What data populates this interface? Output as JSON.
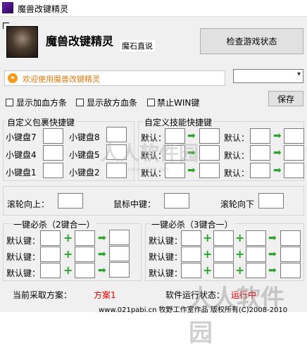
{
  "window": {
    "title": "魔兽改键精灵"
  },
  "header": {
    "app_name": "魔兽改键精灵",
    "subtitle": "魔石直说",
    "check_button": "检查游戏状态"
  },
  "welcome": {
    "text": "欢迎使用魔兽改键精灵"
  },
  "options": {
    "show_hp": "显示加血方条",
    "show_enemy_hp": "显示敌方血条",
    "disable_win": "禁止WIN键",
    "save_button": "保存",
    "dropdown_value": ""
  },
  "inventory": {
    "title": "自定义包裹快捷键",
    "slots": [
      {
        "label": "小键盘7"
      },
      {
        "label": "小键盘8"
      },
      {
        "label": "小键盘4"
      },
      {
        "label": "小键盘5"
      },
      {
        "label": "小键盘1"
      },
      {
        "label": "小键盘2"
      }
    ]
  },
  "skills": {
    "title": "自定义技能快捷键",
    "default_label": "默认："
  },
  "wheel": {
    "up": "滚轮向上：",
    "middle": "鼠标中键：",
    "down": "滚轮向下"
  },
  "combo2": {
    "title": "一键必杀（2键合一）",
    "default_label": "默认键："
  },
  "combo3": {
    "title": "一键必杀（3键合一）",
    "default_label": "默认键："
  },
  "status": {
    "current_label": "当前采取方案：",
    "current_value": "方案1",
    "running_label": "软件运行状态：",
    "running_value": "运行中"
  },
  "footer": {
    "text": "www.021pabi.cn  牧野工作室作品 版权所有(C)2008-2010"
  },
  "watermarks": {
    "center": "人人软件园",
    "bottom": "人人软件园",
    "url": "www.rrrxz.net"
  },
  "colors": {
    "welcome_text": "#e07a10",
    "status_value": "#e00000",
    "plus": "#2aa52a"
  }
}
